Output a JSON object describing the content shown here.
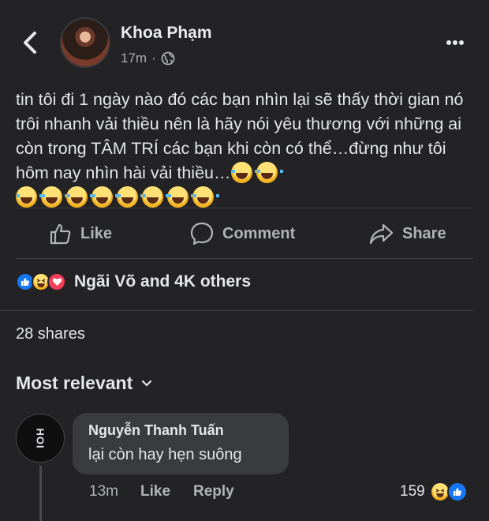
{
  "header": {
    "author": "Khoa Phạm",
    "time": "17m",
    "separator": "·",
    "privacy_icon": "globe-icon",
    "more_icon": "more-dots-icon",
    "back_icon": "chevron-left-icon"
  },
  "post": {
    "text": "tin tôi đi 1 ngày nào đó các bạn nhìn lại sẽ thấy thời gian nó trôi nhanh vải thiều nên là hãy nói yêu thương với những ai còn trong TÂM TRÍ các bạn khi còn có thể…đừng như tôi hôm nay nhìn hài vải thiều…",
    "emoji_name": "laughing-crying-emoji",
    "emoji_count": 10
  },
  "actions": {
    "like": "Like",
    "comment": "Comment",
    "share": "Share"
  },
  "reactions": {
    "summary": "Ngãi Võ and 4K others",
    "icons": [
      "like-icon",
      "haha-icon",
      "love-icon"
    ]
  },
  "shares": "28 shares",
  "sort_label": "Most relevant",
  "comment": {
    "avatar_text": "HOI",
    "author": "Nguyễn Thanh Tuấn",
    "text": "lại còn hay hẹn suông",
    "time": "13m",
    "like": "Like",
    "reply": "Reply",
    "reaction_count": "159"
  },
  "colors": {
    "background": "#232325",
    "bubble": "#3a3b3c",
    "like_blue": "#1877f2",
    "love_red": "#f33e58"
  }
}
